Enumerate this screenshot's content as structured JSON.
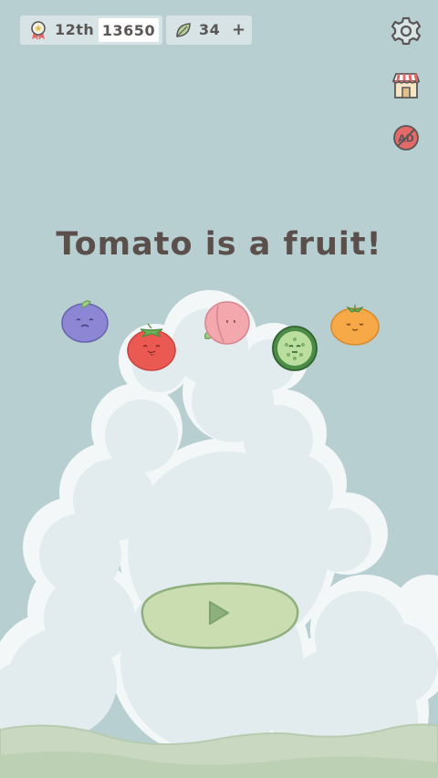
{
  "hud": {
    "rank": "12th",
    "score": "13650",
    "leaves": "34",
    "add_label": "+"
  },
  "icons": {
    "rank": "medal-icon",
    "leaf": "leaf-icon",
    "settings": "gear-icon",
    "shop": "shop-icon",
    "no_ads": "no-ads-icon",
    "play": "play-icon"
  },
  "title": "Tomato is a fruit!",
  "fruits": [
    "blueberry",
    "tomato",
    "peach",
    "cucumber",
    "orange"
  ],
  "colors": {
    "background": "#b8cfd1",
    "cloud": "#e3ecee",
    "cloud_edge": "#f3f7f8",
    "hills": "#c7d8c0",
    "play_fill": "#c9ddb1",
    "play_edge": "#8fb07c",
    "text": "#5a4f4a"
  }
}
